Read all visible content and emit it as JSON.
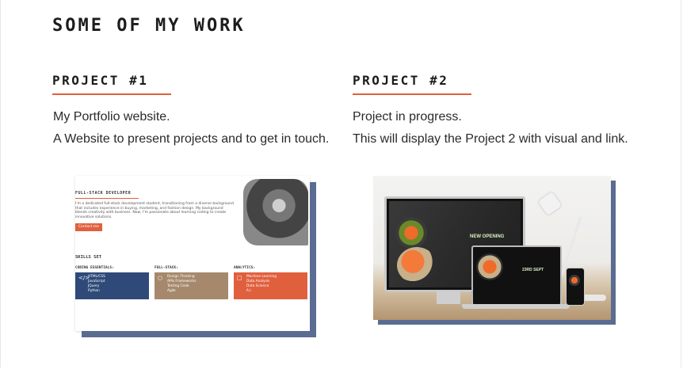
{
  "section": {
    "title": "SOME OF MY WORK"
  },
  "projects": [
    {
      "title": "PROJECT #1",
      "desc1": "My Portfolio website.",
      "desc2": "A Website to present projects and to get in touch."
    },
    {
      "title": "PROJECT #2",
      "desc1": "Project in progress.",
      "desc2": "This will display the Project 2 with visual and link."
    }
  ],
  "thumb1": {
    "role": "FULL-STACK DEVELOPER",
    "bio": "I'm a dedicated full-stack development student, transitioning from a diverse background that includes experience in buying, marketing, and fashion design. My background blends creativity with business. Now, I'm passionate about learning coding to create innovative solutions.",
    "button": "Contact me",
    "skills_title": "SKILLS SET",
    "categories": [
      {
        "name": "CODING ESSENTIALS:",
        "icon": "code-icon",
        "items": [
          "HTML/CSS",
          "JavaScript",
          "JQuery",
          "Python"
        ],
        "color": "#2f4a78"
      },
      {
        "name": "FULL-STACK:",
        "icon": "lightbulb-icon",
        "items": [
          "Design Thinking",
          "APIs Frameworks",
          "Testing Code",
          "Agile"
        ],
        "color": "#a6896c"
      },
      {
        "name": "ANALYTICS:",
        "icon": "document-icon",
        "items": [
          "Machine Learning",
          "Data Analysis",
          "Data Science",
          "A.I."
        ],
        "color": "#e0603e"
      }
    ]
  },
  "thumb2": {
    "screen_text": "NEW OPENING",
    "laptop_date": "23RD SEPT"
  },
  "colors": {
    "accent": "#e0603e",
    "shadow": "#5a6c92"
  }
}
